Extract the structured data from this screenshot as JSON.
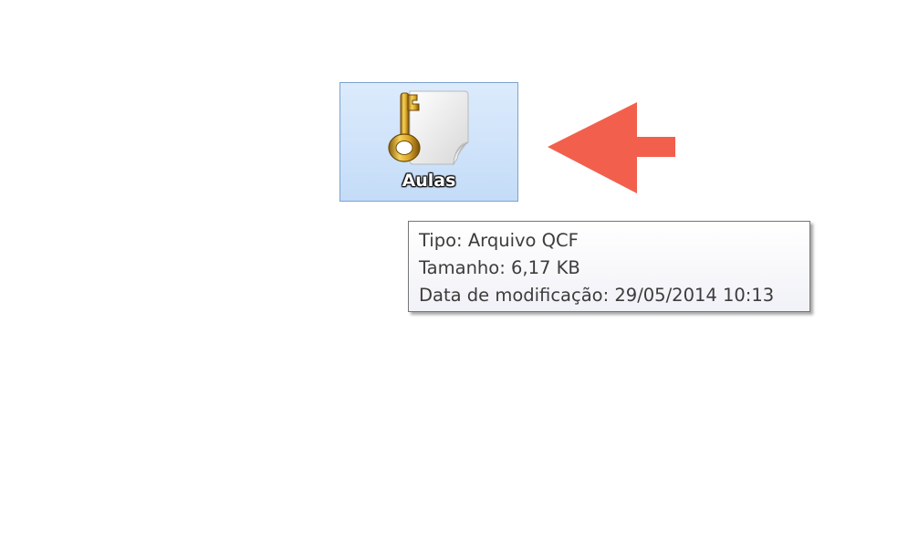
{
  "file": {
    "name": "Aulas",
    "icon": "key-document-icon"
  },
  "pointer_arrow": {
    "color": "#f2604d"
  },
  "tooltip": {
    "type_label": "Tipo:",
    "type_value": "Arquivo QCF",
    "size_label": "Tamanho:",
    "size_value": "6,17 KB",
    "modified_label": "Data de modificação:",
    "modified_value": "29/05/2014 10:13"
  },
  "colors": {
    "selection_bg": "#cce0f8",
    "selection_border": "#7da2ce",
    "tooltip_text": "#3c3c3c"
  }
}
